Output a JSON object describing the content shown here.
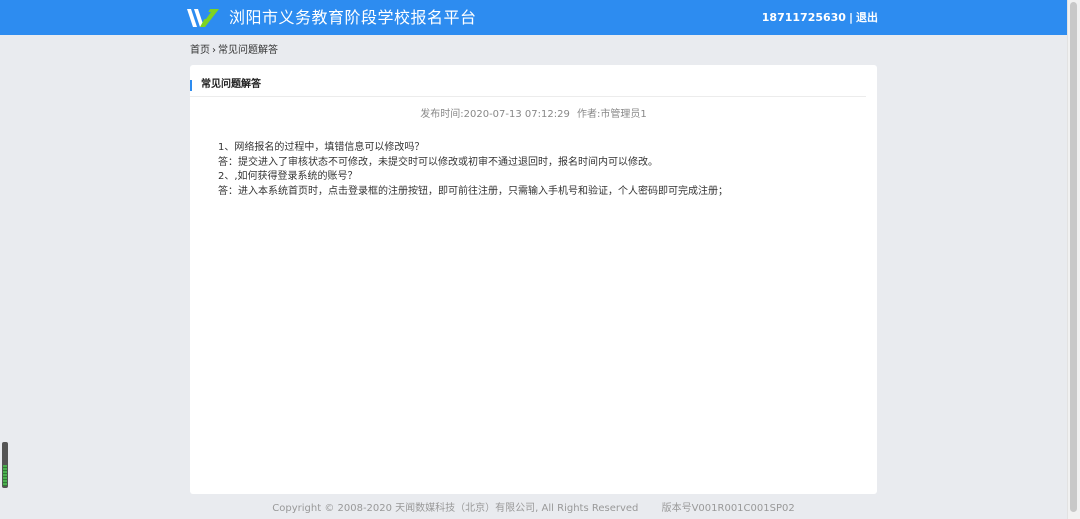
{
  "header": {
    "site_title": "浏阳市义务教育阶段学校报名平台",
    "user_phone": "18711725630",
    "separator": "|",
    "logout": "退出",
    "logo_icon": "logo-icon",
    "bg_color": "#2d8cf0"
  },
  "breadcrumb": {
    "home": "首页",
    "arrow": "›",
    "current": "常见问题解答"
  },
  "article": {
    "heading": "常见问题解答",
    "publish_label": "发布时间:2020-07-13 07:12:29",
    "author_label": "作者:市管理员1",
    "lines": [
      "1、网络报名的过程中，填错信息可以修改吗？",
      "答：提交进入了审核状态不可修改，未提交时可以修改或初审不通过退回时，报名时间内可以修改。",
      "2、,如何获得登录系统的账号？",
      "答：进入本系统首页时，点击登录框的注册按钮，即可前往注册，只需输入手机号和验证，个人密码即可完成注册；"
    ]
  },
  "footer": {
    "copyright": "Copyright © 2008-2020 天闻数媒科技（北京）有限公司, All Rights Reserved",
    "version": "版本号V001R001C001SP02"
  },
  "side_widget": {
    "icon": "volume-level-icon",
    "level": 0.5
  }
}
